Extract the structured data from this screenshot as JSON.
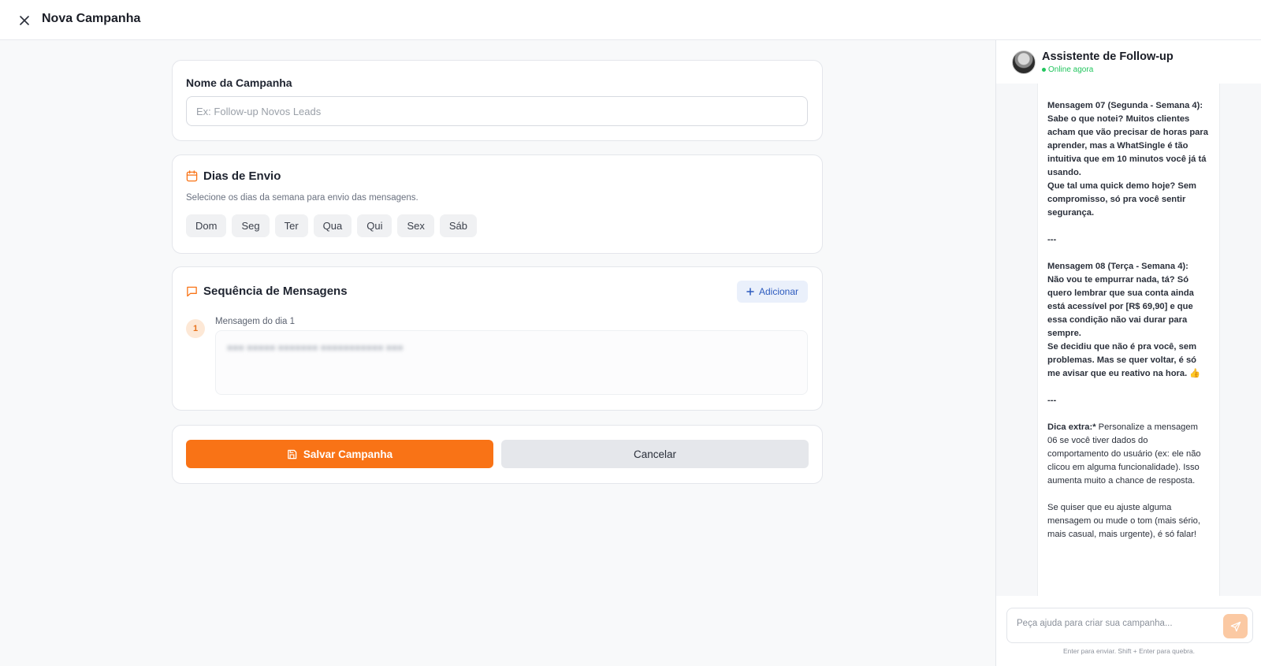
{
  "header": {
    "title": "Nova Campanha",
    "close_icon": "close-icon"
  },
  "campaign_name": {
    "label": "Nome da Campanha",
    "value": "",
    "placeholder": "Ex: Follow-up Novos Leads"
  },
  "send_days": {
    "title": "Dias de Envio",
    "icon": "calendar-icon",
    "description": "Selecione os dias da semana para envio das mensagens.",
    "days": [
      "Dom",
      "Seg",
      "Ter",
      "Qua",
      "Qui",
      "Sex",
      "Sáb"
    ]
  },
  "sequence": {
    "title": "Sequência de Mensagens",
    "icon": "message-square-icon",
    "add_label": "Adicionar",
    "messages": [
      {
        "number": "1",
        "label": "Mensagem do dia 1"
      }
    ]
  },
  "actions": {
    "save_label": "Salvar Campanha",
    "cancel_label": "Cancelar"
  },
  "assistant": {
    "title": "Assistente de Follow-up",
    "status": "Online agora",
    "chat": {
      "m07_title": "Mensagem 07 (Segunda - Semana 4):",
      "m07_body1": "Sabe o que notei? Muitos clientes acham que vão precisar de horas para aprender, mas a WhatSingle é tão intuitiva que em 10 minutos você já tá usando.",
      "m07_body2": "Que tal uma quick demo hoje? Sem compromisso, só pra você sentir segurança.",
      "sep1": "---",
      "m08_title": "Mensagem 08 (Terça - Semana 4):",
      "m08_body1": "Não vou te empurrar nada, tá? Só quero lembrar que sua conta ainda está acessível por [R$ 69,90] e que essa condição não vai durar para sempre.",
      "m08_body2": "Se decidiu que não é pra você, sem problemas. Mas se quer voltar, é só me avisar que eu reativo na hora. 👍",
      "sep2": "---",
      "tip_label": "Dica extra:*",
      "tip_body": " Personalize a mensagem 06 se você tiver dados do comportamento do usuário (ex: ele não clicou em alguma funcionalidade). Isso aumenta muito a chance de resposta.",
      "closing": "Se quiser que eu ajuste alguma mensagem ou mude o tom (mais sério, mais casual, mais urgente), é só falar!"
    },
    "input_placeholder": "Peça ajuda para criar sua campanha...",
    "hint": "Enter para enviar. Shift + Enter para quebra."
  },
  "colors": {
    "accent": "#f97316",
    "online": "#22c55e",
    "add_button_bg": "#eaf0fb",
    "add_button_text": "#2d5bbf"
  }
}
